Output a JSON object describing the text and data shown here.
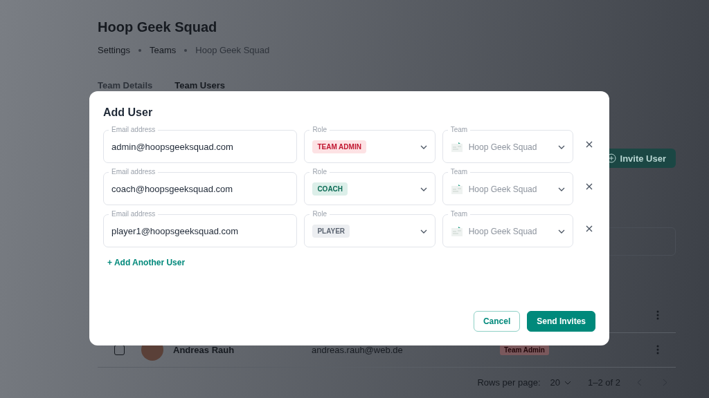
{
  "page": {
    "title": "Hoop Geek Squad",
    "breadcrumbs": [
      {
        "label": "Settings",
        "current": false
      },
      {
        "label": "Teams",
        "current": false
      },
      {
        "label": "Hoop Geek Squad",
        "current": true
      }
    ],
    "tabs": [
      {
        "label": "Team Details",
        "selected": false
      },
      {
        "label": "Team Users",
        "selected": true
      }
    ],
    "invite_button": "Invite User",
    "rows": [
      {
        "name": "",
        "email": "",
        "role": ""
      },
      {
        "name": "Andreas Rauh",
        "email": "andreas.rauh@web.de",
        "role": "Team Admin",
        "checked": false
      }
    ],
    "pagination": {
      "rows_label": "Rows per page:",
      "rows_value": "20",
      "range": "1–2 of 2"
    }
  },
  "dialog": {
    "title": "Add User",
    "users": [
      {
        "email_label": "Email address",
        "email": "admin@hoopsgeeksquad.com",
        "role_label": "Role",
        "role": "TEAM ADMIN",
        "kind": "admin",
        "team_label": "Team",
        "team": "Hoop Geek Squad",
        "team_disabled": true
      },
      {
        "email_label": "Email address",
        "email": "coach@hoopsgeeksquad.com",
        "role_label": "Role",
        "role": "COACH",
        "kind": "coach",
        "team_label": "Team",
        "team": "Hoop Geek Squad",
        "team_disabled": true
      },
      {
        "email_label": "Email address",
        "email": "player1@hoopsgeeksquad.com",
        "role_label": "Role",
        "role": "PLAYER",
        "kind": "player",
        "team_label": "Team",
        "team": "Hoop Geek Squad",
        "team_disabled": true
      }
    ],
    "add_link": "+ Add Another User",
    "buttons": [
      {
        "label": "Cancel",
        "kind": "secondary"
      },
      {
        "label": "Send Invites",
        "kind": "primary"
      }
    ]
  }
}
